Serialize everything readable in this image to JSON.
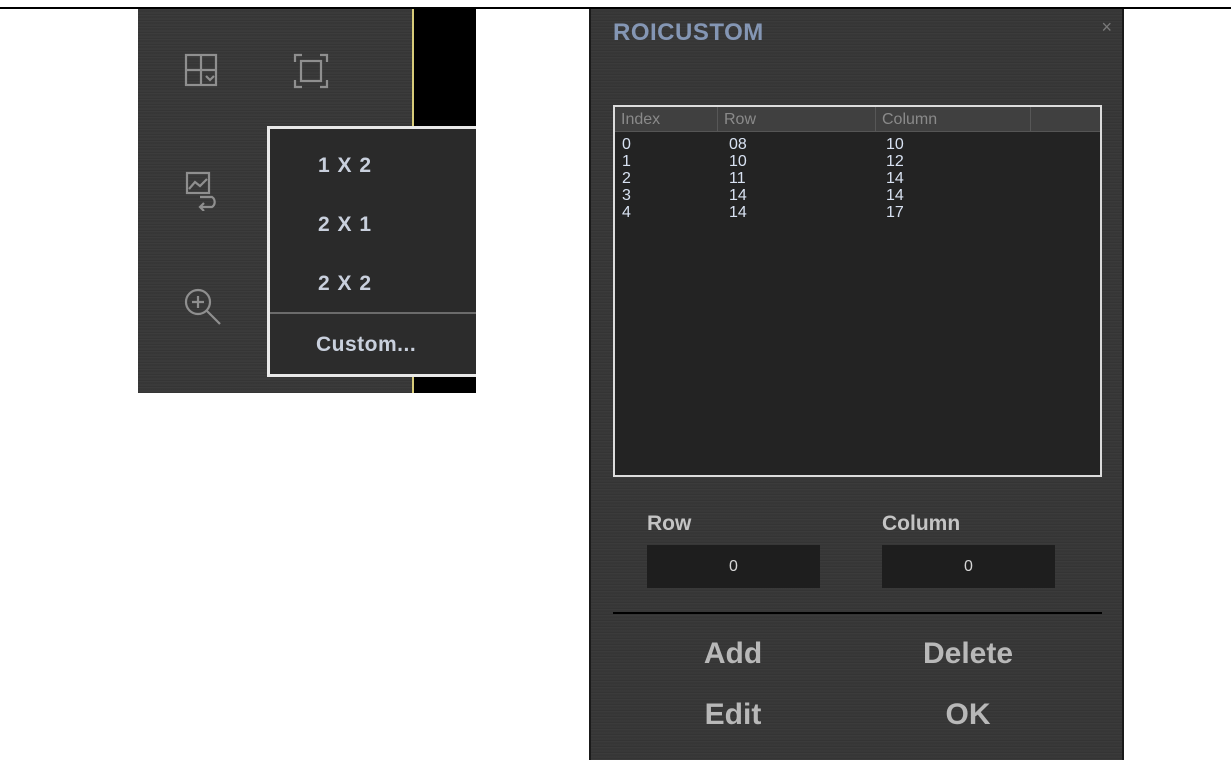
{
  "toolbar": {
    "icons": [
      "layout-grid-icon",
      "fullscreen-icon",
      "image-swap-icon",
      "zoom-in-icon"
    ],
    "menu": {
      "items": [
        "1 X 2",
        "2 X 1",
        "2 X 2"
      ],
      "custom_label": "Custom..."
    }
  },
  "dialog": {
    "title": "ROICUSTOM",
    "close_glyph": "×",
    "table": {
      "columns": [
        "Index",
        "Row",
        "Column"
      ],
      "rows": [
        [
          "0",
          "08",
          "10"
        ],
        [
          "1",
          "10",
          "12"
        ],
        [
          "2",
          "11",
          "14"
        ],
        [
          "3",
          "14",
          "14"
        ],
        [
          "4",
          "14",
          "17"
        ]
      ]
    },
    "row_label": "Row",
    "row_value": "0",
    "column_label": "Column",
    "column_value": "0",
    "buttons": {
      "add": "Add",
      "delete": "Delete",
      "edit": "Edit",
      "ok": "OK"
    }
  },
  "colors": {
    "title": "#8496b4",
    "menu_text": "#c9d0dd",
    "list_text": "#d8e2f2",
    "video_edge": "#d8cc7a"
  }
}
